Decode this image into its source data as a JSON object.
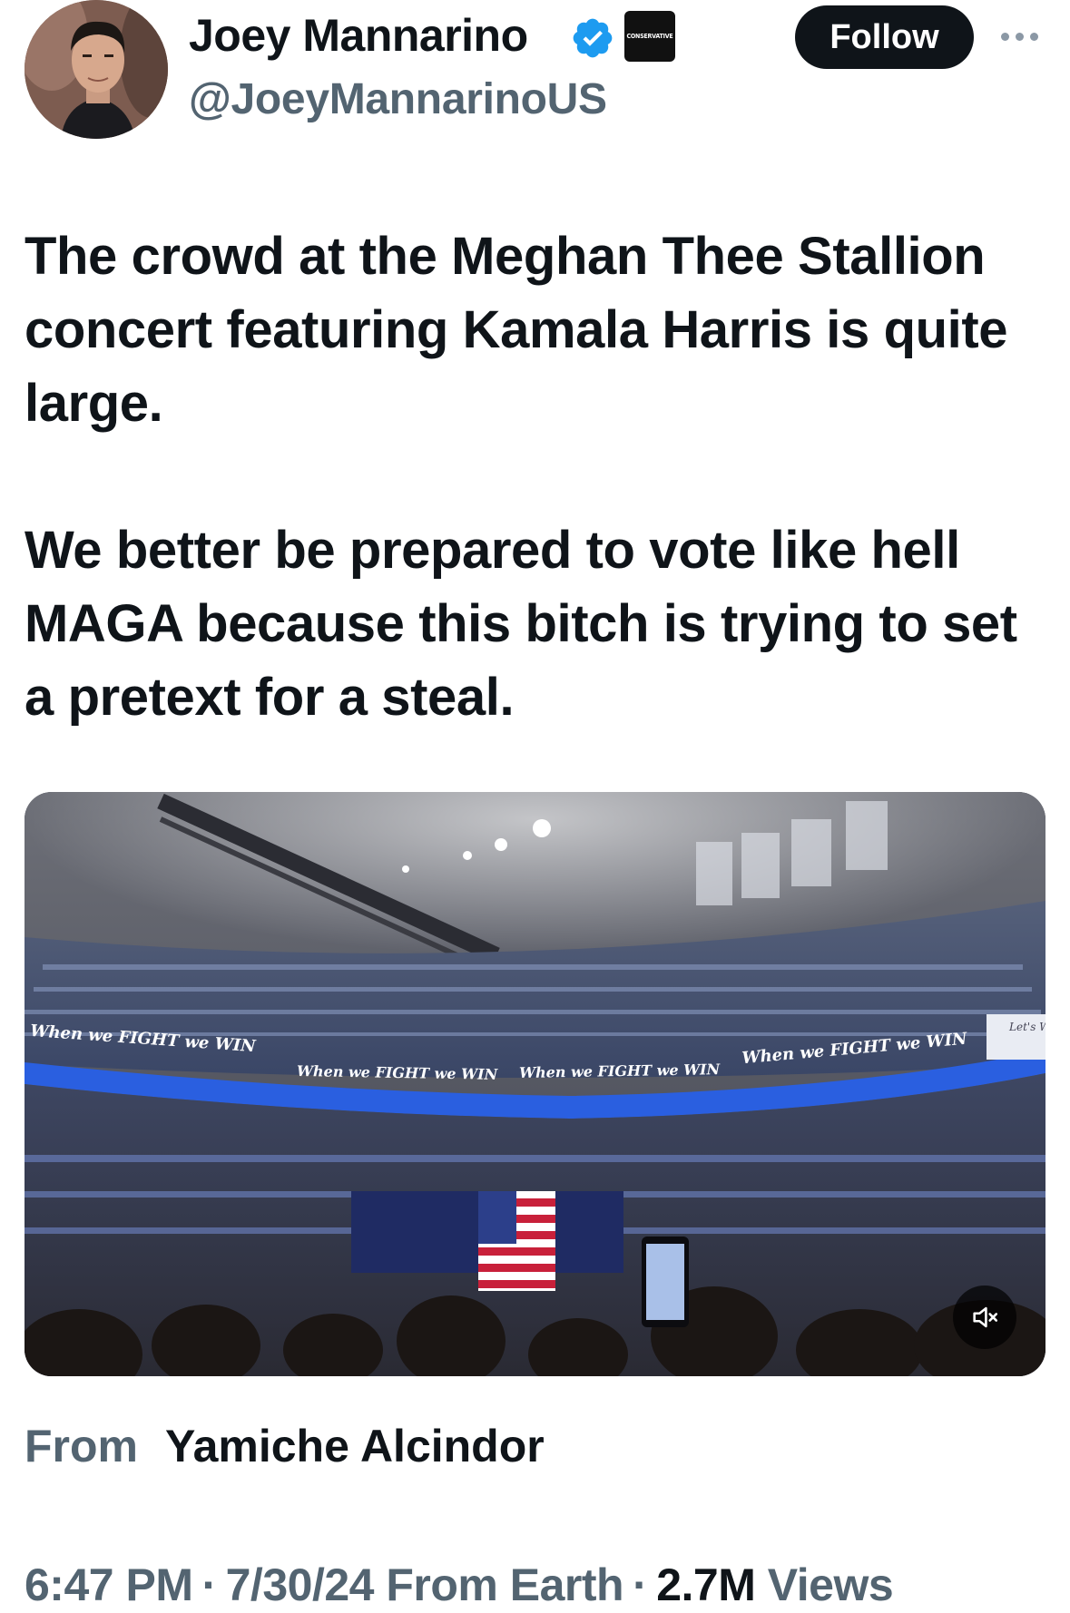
{
  "author": {
    "display_name": "Joey Mannarino",
    "handle": "@JoeyMannarinoUS",
    "verified_icon": "verified-badge-icon",
    "affiliation_badge_text": "CONSERVATIVE",
    "follow_label": "Follow",
    "more_icon": "more-options-icon"
  },
  "tweet": {
    "paragraph_1": "The crowd at the Meghan Thee Stallion concert featuring Kamala Harris is quite large.",
    "paragraph_2": "We better be prepared to vote like hell MAGA because this bitch is trying to set a pretext for a steal."
  },
  "media": {
    "banner_text": "When we FIGHT we WIN",
    "banner_corner_text": "Let's W",
    "mute_icon": "speaker-muted-icon"
  },
  "source": {
    "label": "From",
    "name": "Yamiche Alcindor"
  },
  "meta": {
    "time": "6:47 PM",
    "date": "7/30/24",
    "location": "From Earth",
    "views_count": "2.7M",
    "views_label": "Views"
  },
  "colors": {
    "text_primary": "#0f1419",
    "text_secondary": "#536471",
    "verified_blue": "#1d9bf0",
    "follow_bg": "#0f1419"
  }
}
